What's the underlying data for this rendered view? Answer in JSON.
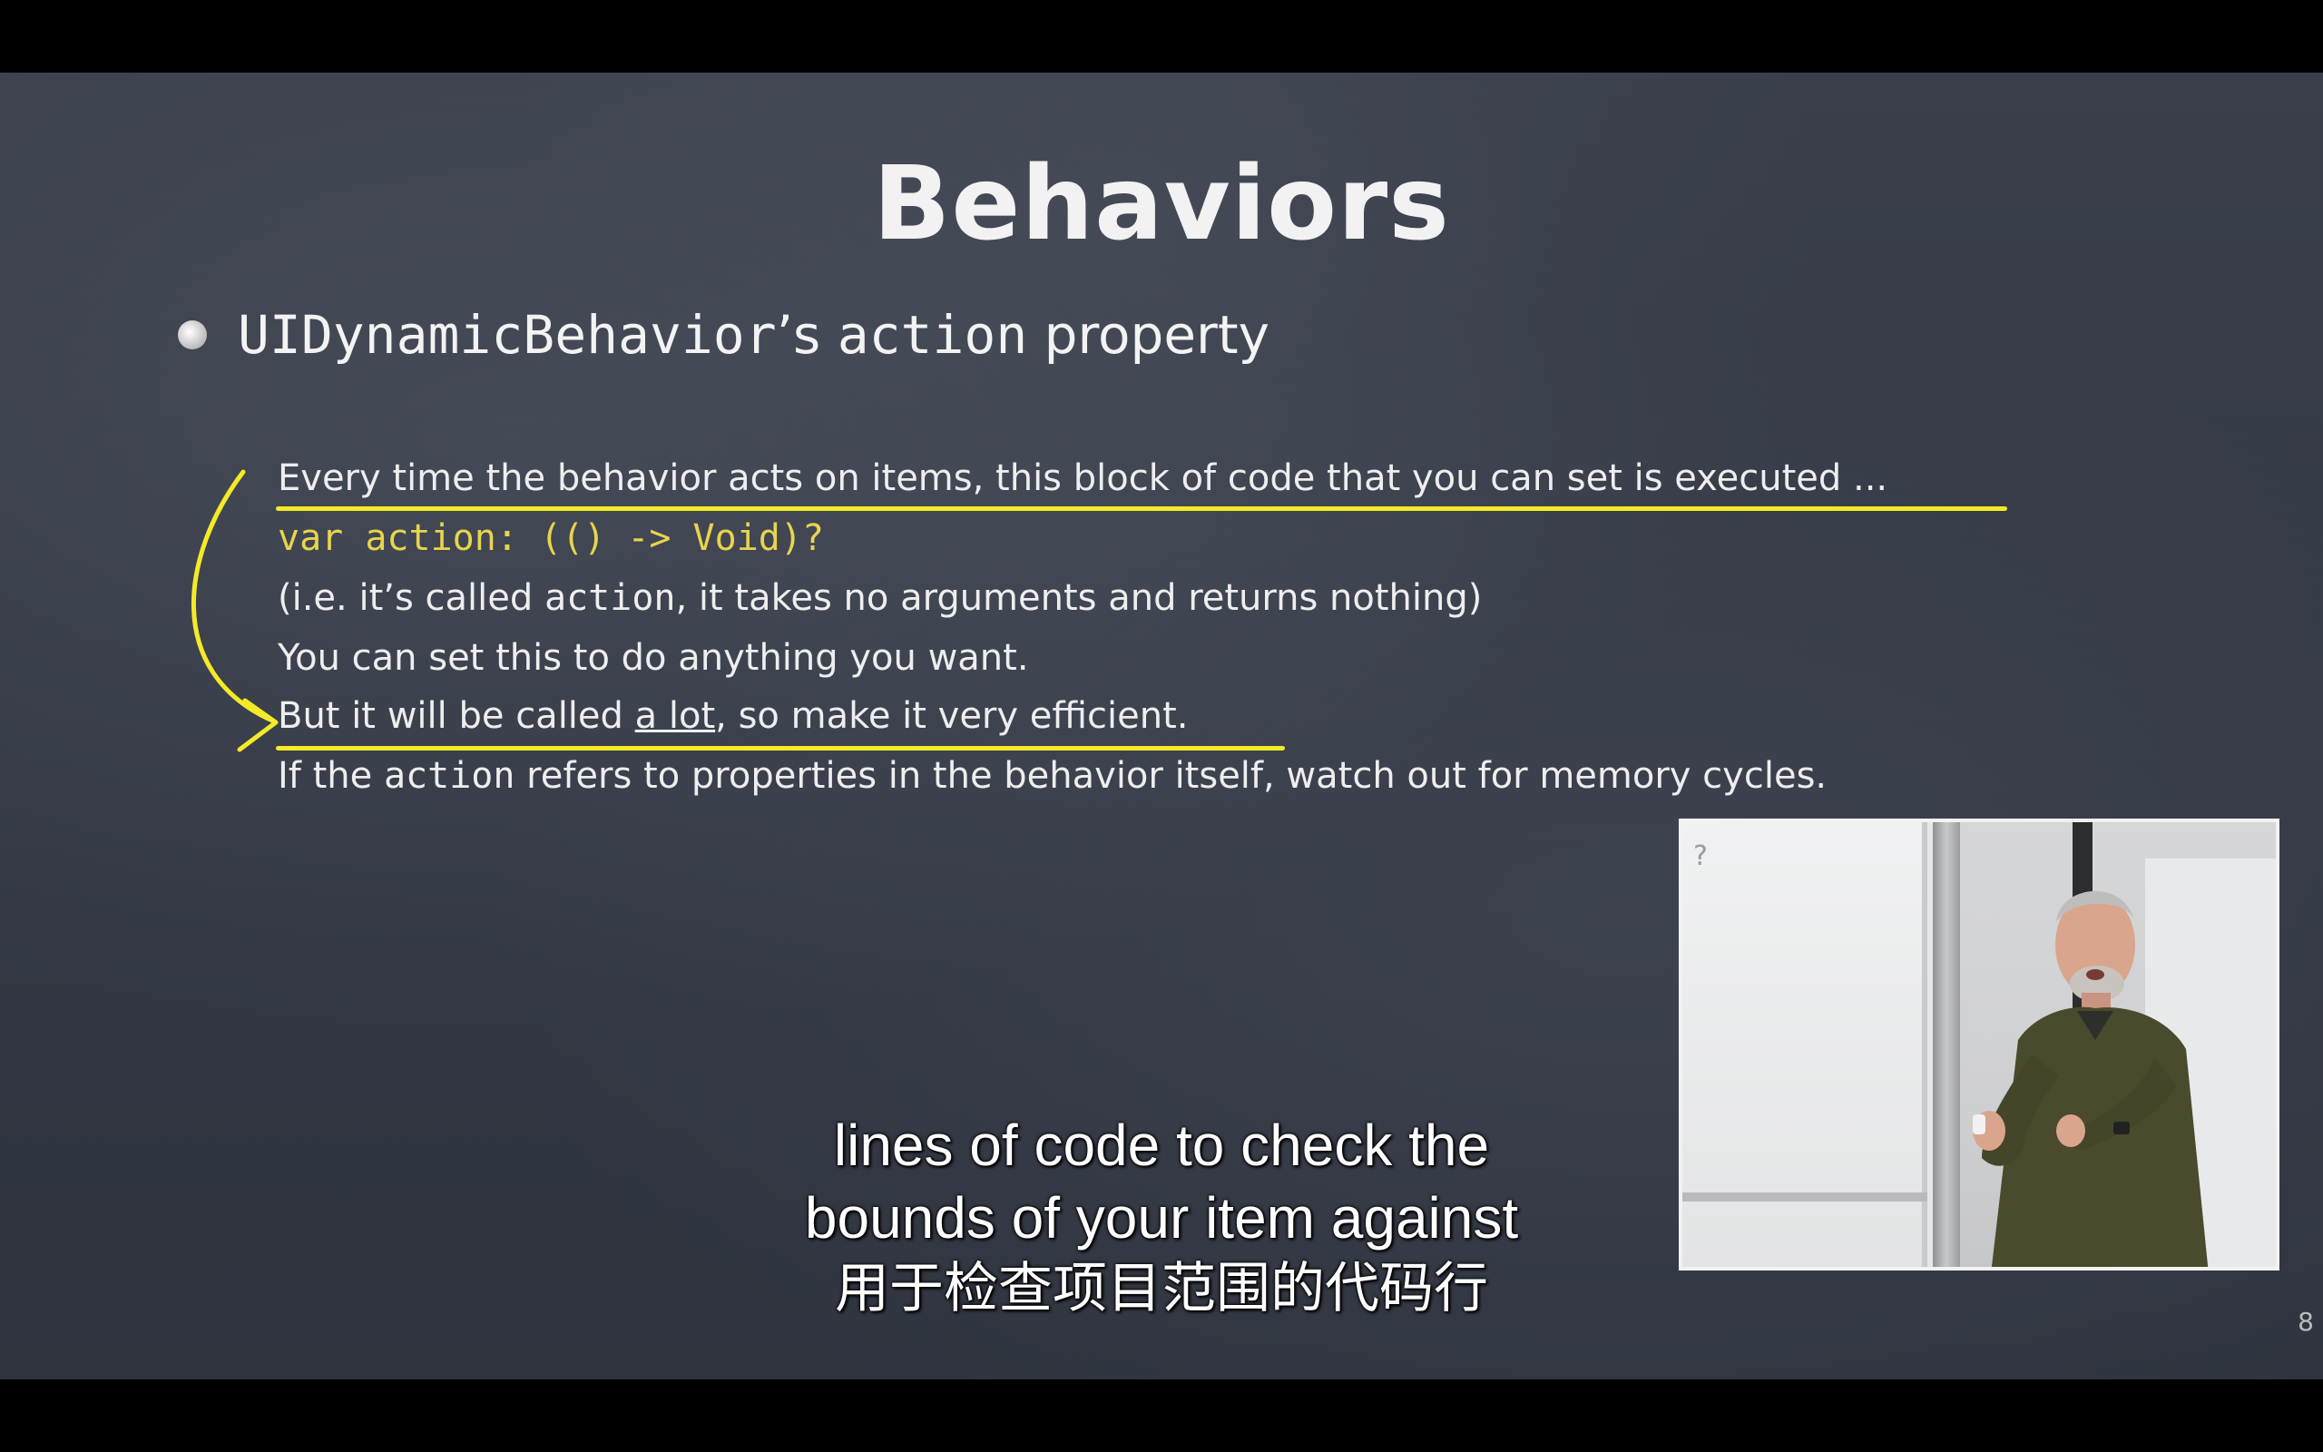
{
  "slide": {
    "title": "Behaviors",
    "bullet": {
      "class_name": "UIDynamicBehavior",
      "suffix": "’s",
      "property_word": "action",
      "tail": "property"
    },
    "lines": [
      {
        "id": "line1",
        "text": "Every time the behavior acts on items, this block of code that you can set is executed ..."
      },
      {
        "id": "line2",
        "text": "var action: (() -> Void)?"
      },
      {
        "id": "line3",
        "prefix": "(i.e. it’s called ",
        "mono": "action",
        "suffix": ", it takes no arguments and returns nothing)"
      },
      {
        "id": "line4",
        "text": "You can set this to do anything you want."
      },
      {
        "id": "line5",
        "prefix": "But it will be called ",
        "underlined": "a lot",
        "suffix": ", so make it very efficient."
      },
      {
        "id": "line6",
        "prefix": "If the ",
        "mono": "action",
        "suffix": " refers to properties in the behavior itself, watch out for memory cycles."
      }
    ],
    "page_number": "8",
    "highlight_color": "#f4ea28",
    "code_color": "#e8d44d"
  },
  "subtitles": {
    "line1": "lines of code to check the",
    "line2": "bounds of your item against",
    "line3": "用于检查项目范围的代码行"
  },
  "pip": {
    "board_mark": "?"
  }
}
